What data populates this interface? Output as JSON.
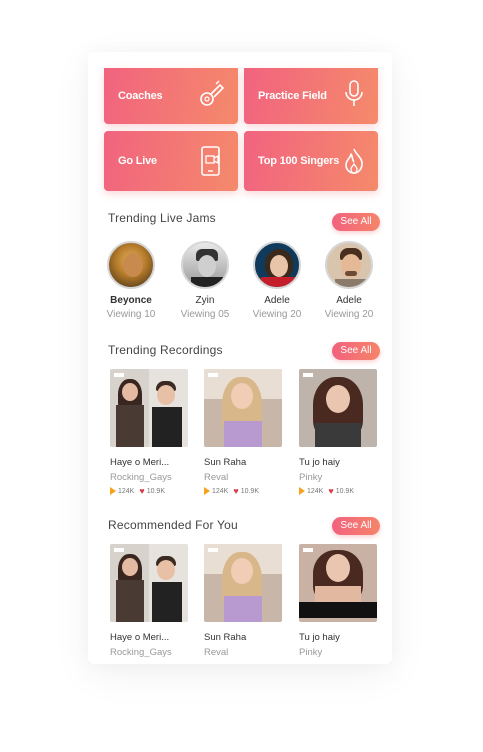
{
  "tiles": [
    {
      "label": "Coaches",
      "icon": "whistle-icon"
    },
    {
      "label": "Practice Field",
      "icon": "microphone-icon"
    },
    {
      "label": "Go Live",
      "icon": "live-video-icon"
    },
    {
      "label": "Top 100 Singers",
      "icon": "flame-icon"
    }
  ],
  "sections": {
    "live_jams": {
      "title": "Trending Live Jams",
      "see_all": "See All"
    },
    "recordings": {
      "title": "Trending Recordings",
      "see_all": "See All"
    },
    "recommended": {
      "title": "Recommended For You",
      "see_all": "See All"
    }
  },
  "live_jams": [
    {
      "name": "Beyonce",
      "viewing": "Viewing 10"
    },
    {
      "name": "Zyin",
      "viewing": "Viewing 05"
    },
    {
      "name": "Adele",
      "viewing": "Viewing 20"
    },
    {
      "name": "Adele",
      "viewing": "Viewing 20"
    }
  ],
  "recordings": [
    {
      "title": "Haye o Meri...",
      "artist": "Rocking_Gays",
      "plays": "124K",
      "likes": "10.9K"
    },
    {
      "title": "Sun Raha",
      "artist": "Reval",
      "plays": "124K",
      "likes": "10.9K"
    },
    {
      "title": "Tu jo haiy",
      "artist": "Pinky",
      "plays": "124K",
      "likes": "10.9K"
    }
  ],
  "recommended": [
    {
      "title": "Haye o Meri...",
      "artist": "Rocking_Gays"
    },
    {
      "title": "Sun Raha",
      "artist": "Reval"
    },
    {
      "title": "Tu jo haiy",
      "artist": "Pinky"
    }
  ],
  "colors": {
    "accent_start": "#f1637f",
    "accent_end": "#f58a6b",
    "heart": "#d93d47",
    "play": "#f6a21c"
  }
}
